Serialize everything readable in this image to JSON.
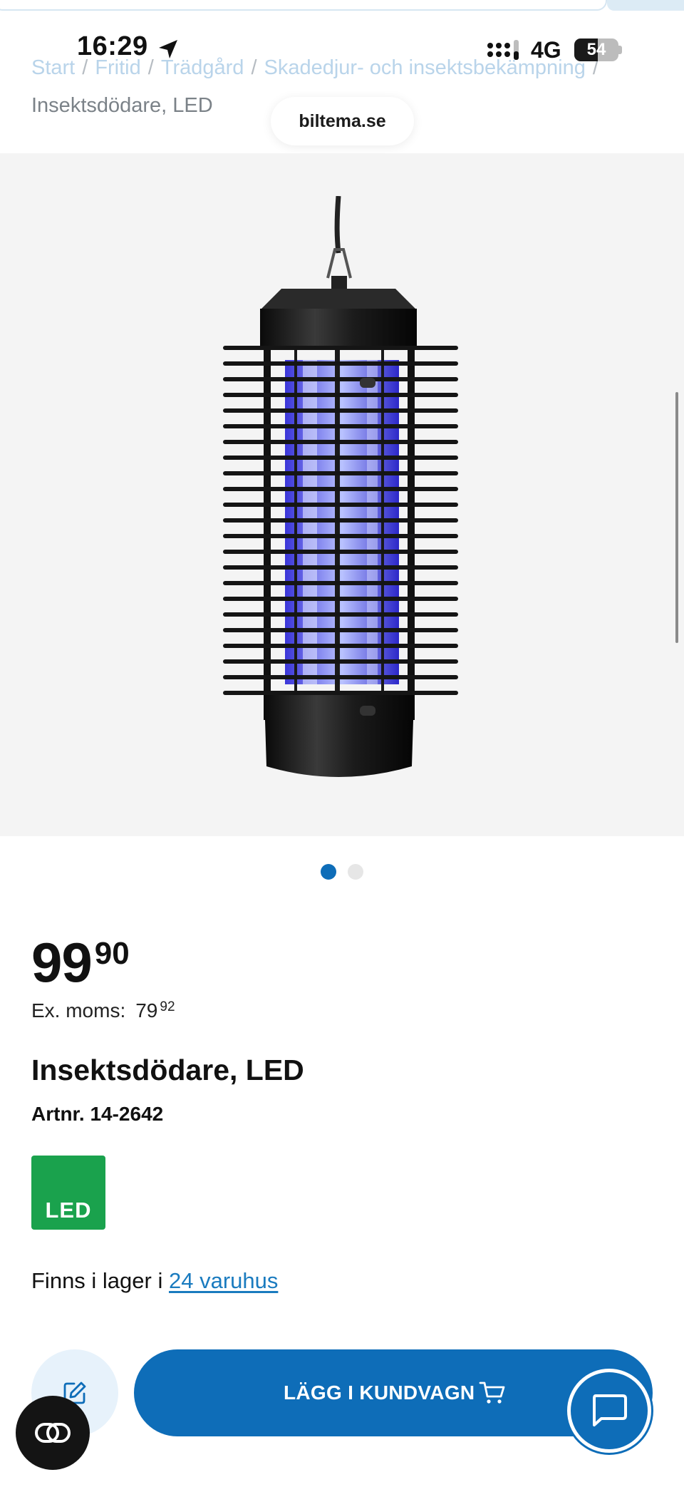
{
  "status_bar": {
    "time": "16:29",
    "network": "4G",
    "battery": "54",
    "battery_level": 0.54
  },
  "browser": {
    "url": "biltema.se"
  },
  "breadcrumb": {
    "items": [
      "Start",
      "Fritid",
      "Trädgård",
      "Skadedjur- och insektsbekämpning"
    ],
    "current": "Insektsdödare, LED"
  },
  "gallery": {
    "image_alt": "Insektsdödare LED product image",
    "slide_count": 2,
    "active_slide": 1
  },
  "product": {
    "price_integer": "99",
    "price_decimal": "90",
    "ex_moms_label": "Ex. moms:",
    "ex_moms_integer": "79",
    "ex_moms_decimal": "92",
    "title": "Insektsdödare, LED",
    "artnr": "Artnr. 14-2642",
    "badge": "LED",
    "stock_prefix": "Finns i lager i",
    "stock_link": "24 varuhus"
  },
  "actions": {
    "add_to_cart": "LÄGG I KUNDVAGN"
  },
  "colors": {
    "primary": "#0e6db8",
    "led_badge": "#1aa24d",
    "link": "#1a7bbf"
  }
}
